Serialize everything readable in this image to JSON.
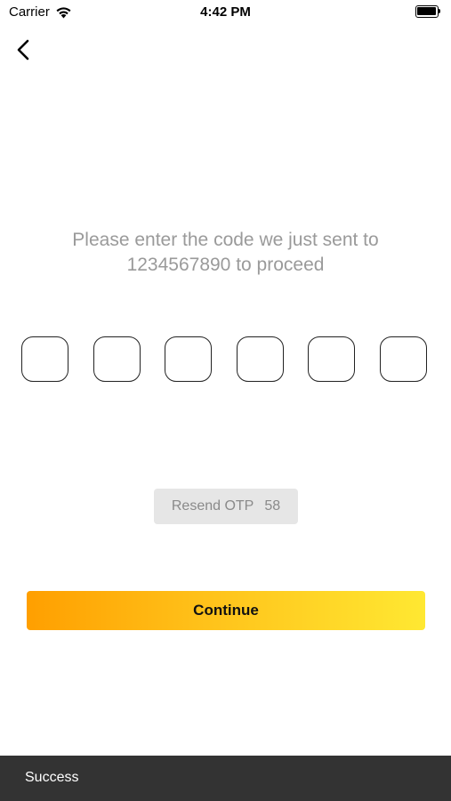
{
  "status_bar": {
    "carrier": "Carrier",
    "time": "4:42 PM",
    "icons": [
      "wifi-icon",
      "battery-icon"
    ]
  },
  "header": {
    "back_icon": "chevron-left-icon"
  },
  "instruction": {
    "text": "Please enter the code we just sent to 1234567890 to proceed"
  },
  "otp": {
    "digits": [
      "",
      "",
      "",
      "",
      "",
      ""
    ]
  },
  "resend": {
    "label": "Resend OTP",
    "countdown": "58"
  },
  "continue": {
    "label": "Continue"
  },
  "snackbar": {
    "message": "Success"
  },
  "colors": {
    "instruction_text": "#9a9a9a",
    "continue_gradient_start": "#ff9f00",
    "continue_gradient_end": "#ffe832",
    "resend_bg": "#e6e6e6",
    "snackbar_bg": "#333333"
  }
}
